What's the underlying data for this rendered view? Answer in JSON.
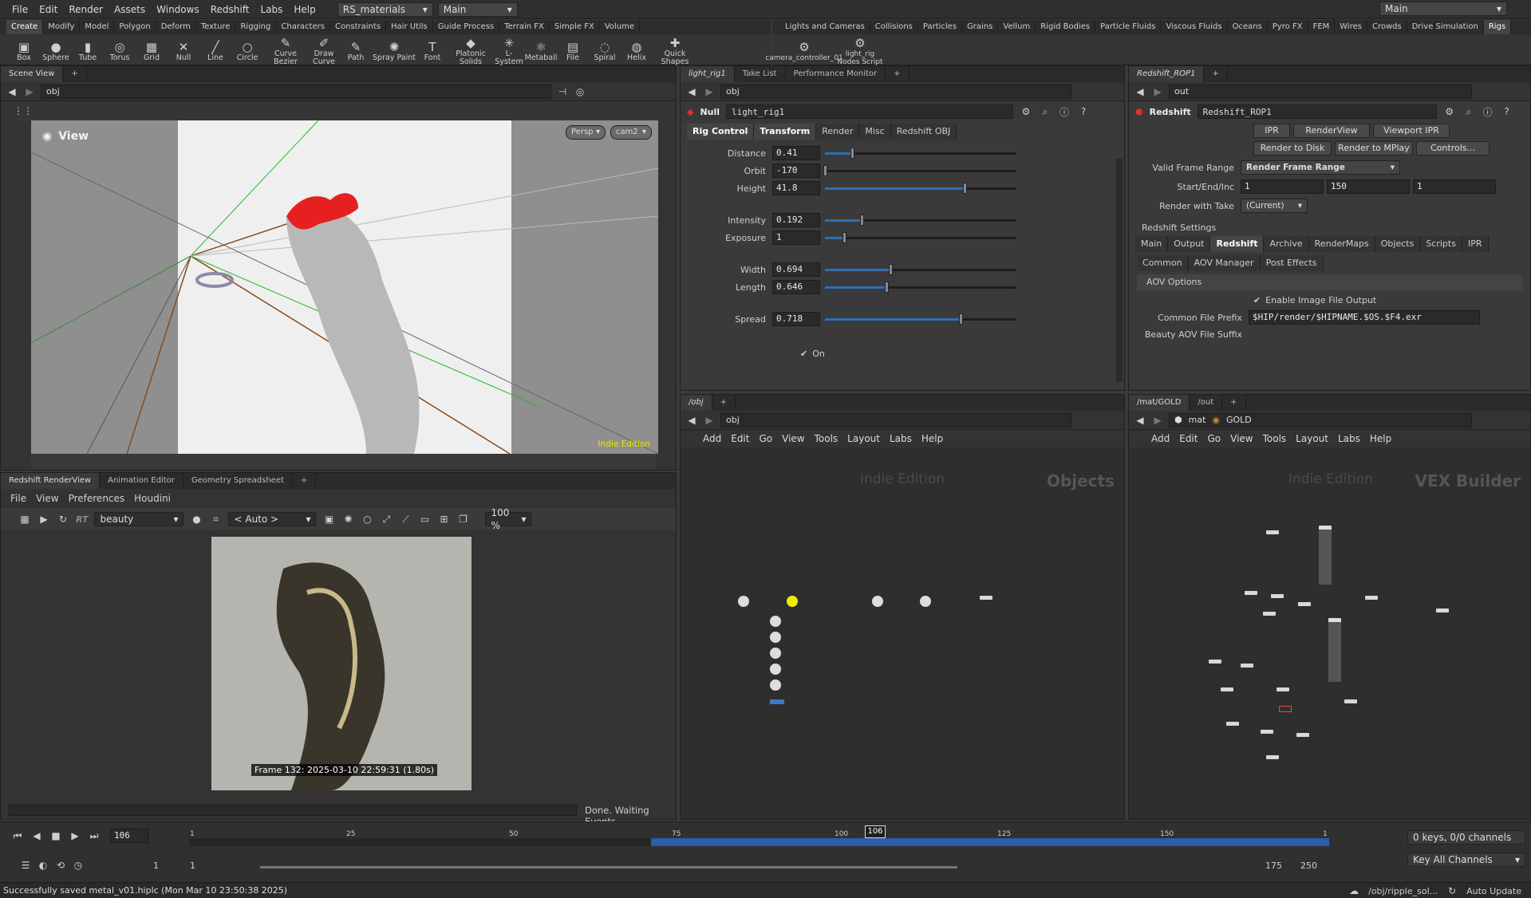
{
  "menubar": {
    "items": [
      "File",
      "Edit",
      "Render",
      "Assets",
      "Windows",
      "Redshift",
      "Labs",
      "Help"
    ],
    "desktop": "RS_materials",
    "context": "Main",
    "right_context": "Main"
  },
  "shelf_left": {
    "tabs": [
      "Create",
      "Modify",
      "Model",
      "Polygon",
      "Deform",
      "Texture",
      "Rigging",
      "Characters",
      "Constraints",
      "Hair Utils",
      "Guide Process",
      "Terrain FX",
      "Simple FX",
      "Volume"
    ],
    "tools": [
      "Box",
      "Sphere",
      "Tube",
      "Torus",
      "Grid",
      "Null",
      "Line",
      "Circle",
      "Curve Bezier",
      "Draw Curve",
      "Path",
      "Spray Paint",
      "Font",
      "Platonic Solids",
      "L-System",
      "Metaball",
      "File",
      "Spiral",
      "Helix",
      "Quick Shapes"
    ]
  },
  "shelf_right": {
    "tabs": [
      "Lights and Cameras",
      "Collisions",
      "Particles",
      "Grains",
      "Vellum",
      "Rigid Bodies",
      "Particle Fluids",
      "Viscous Fluids",
      "Oceans",
      "Pyro FX",
      "FEM",
      "Wires",
      "Crowds",
      "Drive Simulation",
      "Rigs"
    ],
    "tools": [
      "camera_controller_01",
      "light_rig Nodes Script"
    ]
  },
  "scene_view": {
    "tab": "Scene View",
    "path": "obj",
    "view_label": "View",
    "persp": "Persp",
    "cam": "cam2",
    "watermark": "Indie Edition"
  },
  "parm_panel": {
    "tabs": [
      "light_rig1",
      "Take List",
      "Performance Monitor"
    ],
    "path": "obj",
    "node_type": "Null",
    "node_name": "light_rig1",
    "subtabs": [
      "Rig Control",
      "Transform",
      "Render",
      "Misc",
      "Redshift OBJ"
    ],
    "parms": [
      {
        "label": "Distance",
        "value": "0.41",
        "frac": 0.14
      },
      {
        "label": "Orbit",
        "value": "-170",
        "frac": 0.0
      },
      {
        "label": "Height",
        "value": "41.8",
        "frac": 0.73
      },
      {
        "label": "Intensity",
        "value": "0.192",
        "frac": 0.19
      },
      {
        "label": "Exposure",
        "value": "1",
        "frac": 0.1
      },
      {
        "label": "Width",
        "value": "0.694",
        "frac": 0.34
      },
      {
        "label": "Length",
        "value": "0.646",
        "frac": 0.32
      },
      {
        "label": "Spread",
        "value": "0.718",
        "frac": 0.71
      }
    ],
    "toggle": "On"
  },
  "rop_panel": {
    "tab": "Redshift_ROP1",
    "path": "out",
    "node_type": "Redshift",
    "node_name": "Redshift_ROP1",
    "buttons_row1": [
      "IPR",
      "RenderView",
      "Viewport IPR"
    ],
    "buttons_row2": [
      "Render to Disk",
      "Render to MPlay",
      "Controls..."
    ],
    "valid_frame_label": "Valid Frame Range",
    "valid_frame_value": "Render Frame Range",
    "startend_label": "Start/End/Inc",
    "start": "1",
    "end": "150",
    "inc": "1",
    "take_label": "Render with Take",
    "take_value": "(Current)",
    "settings_label": "Redshift Settings",
    "tabs1": [
      "Main",
      "Output",
      "Redshift",
      "Archive",
      "RenderMaps",
      "Objects",
      "Scripts",
      "IPR"
    ],
    "tabs2": [
      "Common",
      "AOV Manager",
      "Post Effects"
    ],
    "aov_header": "AOV Options",
    "enable_label": "Enable Image File Output",
    "prefix_label": "Common File Prefix",
    "prefix_value": "$HIP/render/$HIPNAME.$OS.$F4.exr",
    "beauty_label": "Beauty AOV File Suffix"
  },
  "obj_net": {
    "tab": "/obj",
    "path": "obj",
    "menu": [
      "Add",
      "Edit",
      "Go",
      "View",
      "Tools",
      "Layout",
      "Labs",
      "Help"
    ],
    "watermark": "Indie Edition",
    "context_label": "Objects"
  },
  "mat_net": {
    "tabs": [
      "/mat/GOLD",
      "/out"
    ],
    "path1": "mat",
    "path2": "GOLD",
    "menu": [
      "Add",
      "Edit",
      "Go",
      "View",
      "Tools",
      "Layout",
      "Labs",
      "Help"
    ],
    "watermark": "Indie Edition",
    "context_label": "VEX Builder"
  },
  "renderview": {
    "tabs": [
      "Redshift RenderView",
      "Animation Editor",
      "Geometry Spreadsheet"
    ],
    "menu": [
      "File",
      "View",
      "Preferences",
      "Houdini"
    ],
    "aov": "beauty",
    "auto": "< Auto >",
    "zoom": "100 %",
    "caption": "Frame  132: 2025-03-10 22:59:31 (1.80s)",
    "status": "Done. Waiting Events"
  },
  "timeline": {
    "current_frame": "106",
    "marker": "106",
    "ticks": [
      "1",
      "25",
      "50",
      "75",
      "100",
      "125",
      "150",
      "1"
    ],
    "range_start": "1",
    "range_start2": "1",
    "range_end": "175",
    "range_end2": "250",
    "keys": "0 keys, 0/0 channels",
    "key_all": "Key All Channels"
  },
  "statusbar": {
    "message": "Successfully saved metal_v01.hiplc (Mon Mar 10 23:50:38 2025)",
    "path": "/obj/ripple_sol...",
    "update": "Auto Update"
  }
}
